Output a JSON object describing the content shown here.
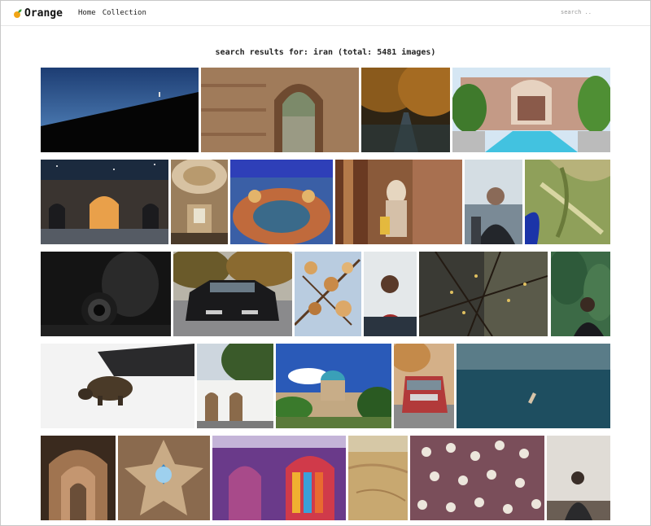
{
  "header": {
    "brand": "Orange",
    "nav": [
      "Home",
      "Collection"
    ],
    "search_placeholder": "search .."
  },
  "results": {
    "text": "search results for: iran (total: 5481 images)"
  },
  "colors": {
    "brand_accent": "#f2a516"
  },
  "images": [
    {
      "name": "silhouette-hill-photo"
    },
    {
      "name": "brick-arch-photo"
    },
    {
      "name": "autumn-road-photo"
    },
    {
      "name": "palace-pool-photo"
    },
    {
      "name": "night-ruins-photo"
    },
    {
      "name": "mosque-dome-photo"
    },
    {
      "name": "tile-ceiling-photo"
    },
    {
      "name": "woman-doorway-photo"
    },
    {
      "name": "old-man-photo"
    },
    {
      "name": "aerial-terrain-photo"
    },
    {
      "name": "camera-lens-photo"
    },
    {
      "name": "black-car-photo"
    },
    {
      "name": "blossom-branch-photo"
    },
    {
      "name": "man-thinking-photo"
    },
    {
      "name": "twigs-bokeh-photo"
    },
    {
      "name": "woman-forest-photo"
    },
    {
      "name": "turtle-photo"
    },
    {
      "name": "white-building-photo"
    },
    {
      "name": "blue-dome-photo"
    },
    {
      "name": "red-car-photo"
    },
    {
      "name": "sea-swimmer-photo"
    },
    {
      "name": "arched-corridor-photo"
    },
    {
      "name": "star-ceiling-photo"
    },
    {
      "name": "stained-glass-photo"
    },
    {
      "name": "desert-aerial-photo"
    },
    {
      "name": "flowers-photo"
    },
    {
      "name": "woman-portrait-photo"
    }
  ]
}
